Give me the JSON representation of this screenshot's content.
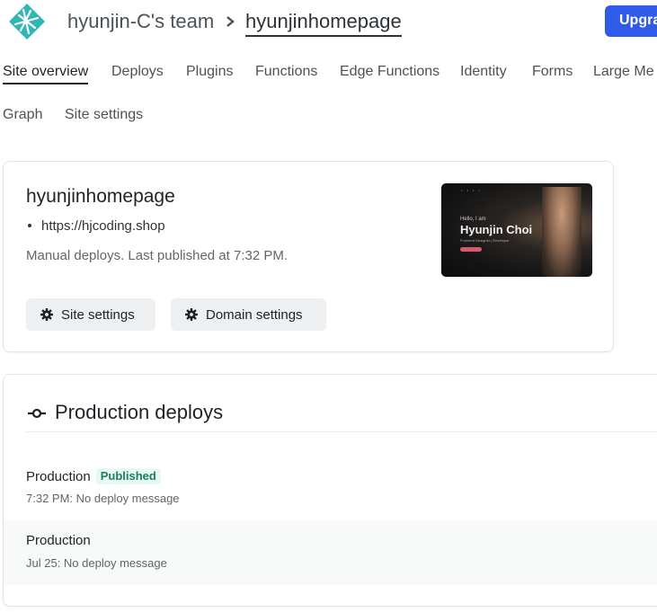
{
  "header": {
    "team": "hyunjin-C's team",
    "site": "hyunjinhomepage",
    "upgrade_label": "Upgra"
  },
  "tabs": [
    {
      "label": "Site overview",
      "active": true
    },
    {
      "label": "Deploys"
    },
    {
      "label": "Plugins"
    },
    {
      "label": "Functions"
    },
    {
      "label": "Edge Functions"
    },
    {
      "label": "Identity"
    },
    {
      "label": "Forms"
    },
    {
      "label": "Large Me"
    },
    {
      "label": "Graph"
    },
    {
      "label": "Site settings"
    }
  ],
  "site_card": {
    "name": "hyunjinhomepage",
    "url": "https://hjcoding.shop",
    "deploy_info": "Manual deploys. Last published at 7:32 PM.",
    "site_settings_label": "Site settings",
    "domain_settings_label": "Domain settings",
    "preview": {
      "hello": "Hello, I am",
      "name": "Hyunjin Choi",
      "role": "Frontend Designer | Developer"
    }
  },
  "production": {
    "title": "Production deploys",
    "deploys": [
      {
        "label": "Production",
        "badge": "Published",
        "meta": "7:32 PM: No deploy message"
      },
      {
        "label": "Production",
        "meta": "Jul 25: No deploy message"
      }
    ]
  },
  "colors": {
    "accent": "#2f5bea",
    "published_badge_bg": "#e8f8f2",
    "published_badge_text": "#1a7f5a",
    "logo": "#30b7b5"
  }
}
